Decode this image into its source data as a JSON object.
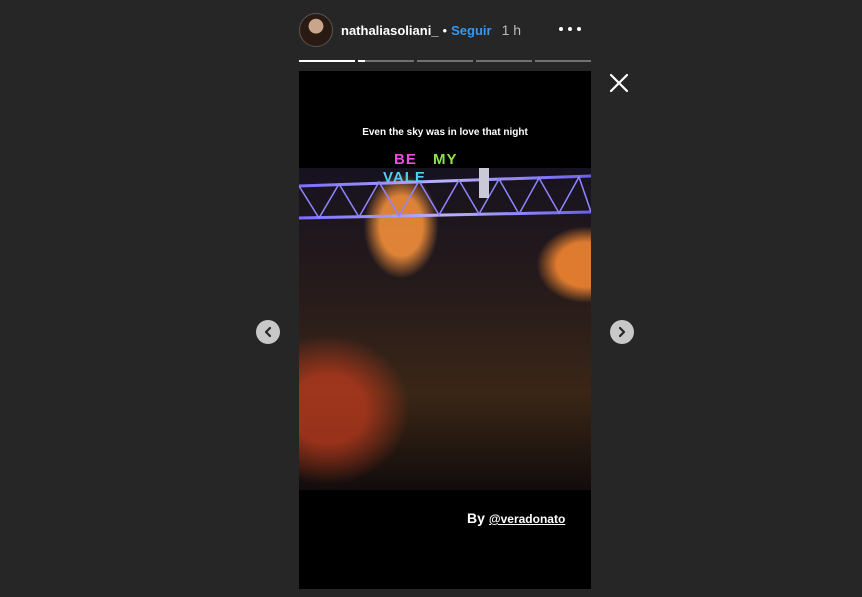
{
  "header": {
    "avatar_alt": "avatar",
    "username": "nathaliasoliani_",
    "separator": "•",
    "follow_label": "Seguir",
    "time_ago": "1 h",
    "more_icon": "more-horizontal-icon"
  },
  "progress": {
    "segments": [
      1.0,
      0.12,
      0,
      0,
      0
    ]
  },
  "controls": {
    "close_icon": "close-icon",
    "prev_icon": "chevron-left-icon",
    "next_icon": "chevron-right-icon"
  },
  "story": {
    "caption": "Even the sky was in love that night",
    "neon_line1_word1": "BE",
    "neon_line1_word2": "MY",
    "neon_line2": "VALE",
    "credit_prefix": "By",
    "credit_mention": "@veradonato"
  },
  "colors": {
    "background": "#262626",
    "follow": "#3897f0",
    "story_bg": "#000000"
  }
}
